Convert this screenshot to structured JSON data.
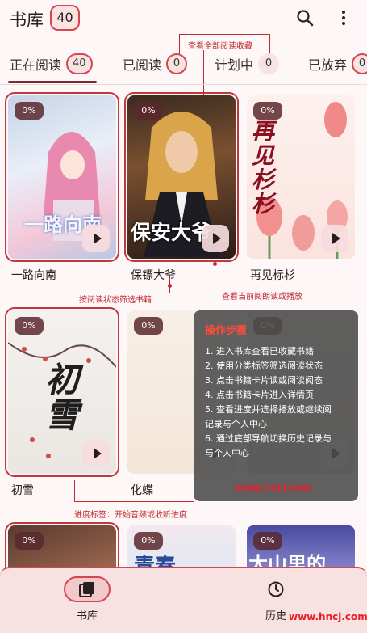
{
  "header": {
    "title": "书库",
    "count": "40"
  },
  "tabs": [
    {
      "label": "正在阅读",
      "count": "40"
    },
    {
      "label": "已阅读",
      "count": "0"
    },
    {
      "label": "计划中",
      "count": "0"
    },
    {
      "label": "已放弃",
      "count": "0"
    }
  ],
  "books": [
    {
      "title": "一路向南",
      "progress": "0%",
      "cover_text": "一路向南"
    },
    {
      "title": "保镖大爷",
      "progress": "0%",
      "cover_text": "保安大爷"
    },
    {
      "title": "再见标杉",
      "progress": "0%",
      "cover_text": "再见杉杉"
    },
    {
      "title": "初雪",
      "progress": "0%",
      "cover_text": "初雪"
    },
    {
      "title": "化蝶",
      "progress": "0%",
      "cover_text": ""
    },
    {
      "title": "",
      "progress": "0%",
      "cover_text": ""
    },
    {
      "title": "",
      "progress": "0%",
      "cover_text": ""
    },
    {
      "title": "",
      "progress": "0%",
      "cover_text": "青春"
    },
    {
      "title": "",
      "progress": "0%",
      "cover_text": "大山里的"
    }
  ],
  "annotations": {
    "view_all": "查看全部阅读收藏",
    "filter": "按阅读状态筛选书籍",
    "view_current": "查看当前阅朗读或播放",
    "progress_tag": "进度标签：开始音频或收听进度"
  },
  "steps": {
    "title": "操作步骤",
    "items": [
      "1. 进入书库查看已收藏书籍",
      "2. 使用分类标签筛选阅读状态",
      "3. 点击书籍卡片读或阅读阅态",
      "4. 点击书籍卡片进入详情页",
      "5. 查看进度并选择播放或继续阅",
      "   记录与个人中心",
      "6. 通过底部导航切换历史记录与",
      "   与个人中心"
    ]
  },
  "watermark": "www.hncj.com",
  "bottom_nav": [
    {
      "label": "书库",
      "icon": "library-icon"
    },
    {
      "label": "历史",
      "icon": "history-icon"
    }
  ],
  "colors": {
    "accent": "#d8454d",
    "dark_accent": "#7a2a30",
    "background": "#fdf7f7"
  }
}
